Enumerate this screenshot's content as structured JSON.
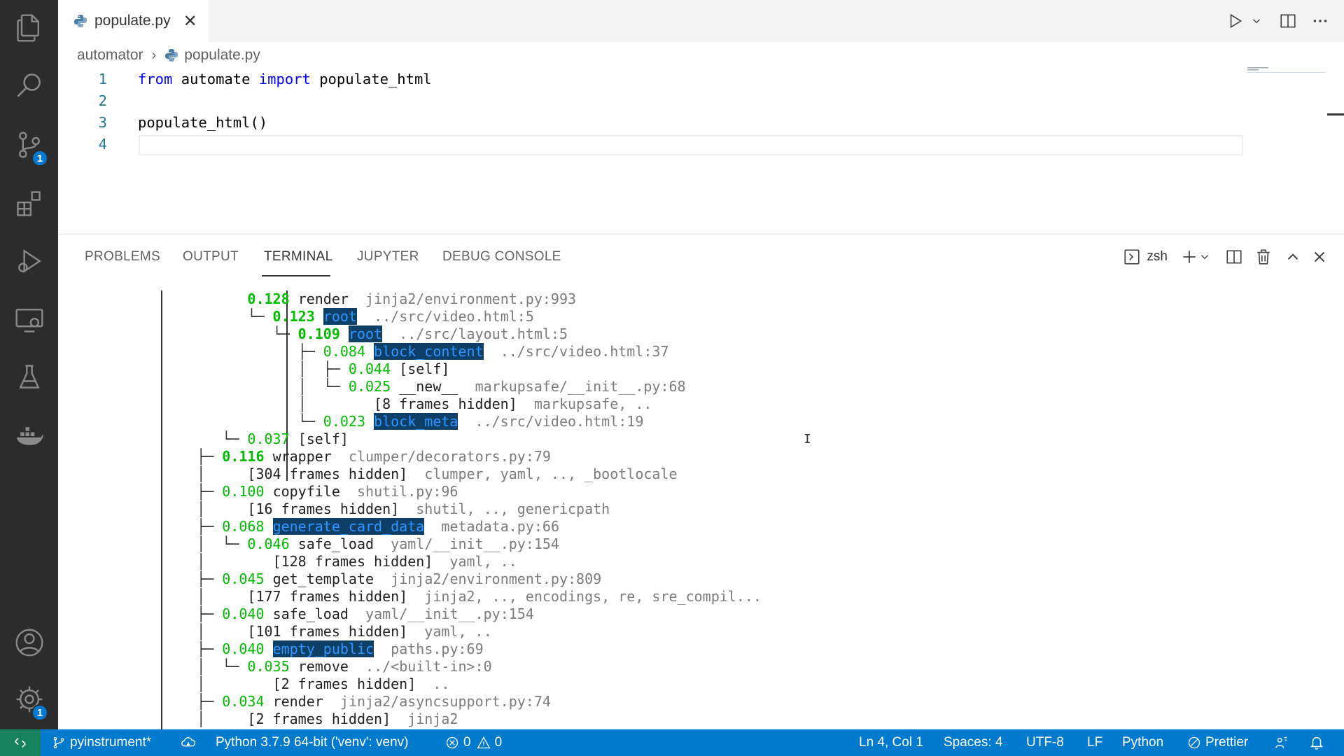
{
  "activity_bar": {
    "scm_badge": "1",
    "settings_badge": "1"
  },
  "editor": {
    "tab_name": "populate.py",
    "breadcrumb": [
      "automator",
      "populate.py"
    ],
    "lines": [
      {
        "num": "1",
        "text": "from automate import populate_html"
      },
      {
        "num": "2",
        "text": ""
      },
      {
        "num": "3",
        "text": "populate_html()"
      },
      {
        "num": "4",
        "text": ""
      }
    ],
    "keywords": [
      "from",
      "import"
    ]
  },
  "panel": {
    "tabs": [
      "PROBLEMS",
      "OUTPUT",
      "TERMINAL",
      "JUPYTER",
      "DEBUG CONSOLE"
    ],
    "active_tab": "TERMINAL",
    "shell": "zsh"
  },
  "terminal": {
    "lines": [
      {
        "prefix": "          ",
        "num": "0.128",
        "name": "render",
        "src": "jinja2/environment.py:993",
        "bold": true
      },
      {
        "prefix": "          └─ ",
        "num": "0.123",
        "name": "root",
        "src": "../src/video.html:5",
        "bold": true,
        "hl": true
      },
      {
        "prefix": "             └─ ",
        "num": "0.109",
        "name": "root",
        "src": "../src/layout.html:5",
        "bold": true,
        "hl": true
      },
      {
        "prefix": "                ├─ ",
        "num": "0.084",
        "name": "block_content",
        "src": "../src/video.html:37",
        "hl": true
      },
      {
        "prefix": "                │  ├─ ",
        "num": "0.044",
        "name": "[self]",
        "src": ""
      },
      {
        "prefix": "                │  └─ ",
        "num": "0.025",
        "name": "__new__",
        "src": "markupsafe/__init__.py:68"
      },
      {
        "prefix": "                │        ",
        "num": "",
        "name": "[8 frames hidden]",
        "src": "markupsafe, .."
      },
      {
        "prefix": "                └─ ",
        "num": "0.023",
        "name": "block_meta",
        "src": "../src/video.html:19",
        "hl": true
      },
      {
        "prefix": "       └─ ",
        "num": "0.037",
        "name": "[self]",
        "src": ""
      },
      {
        "prefix": "    ├─ ",
        "num": "0.116",
        "name": "wrapper",
        "src": "clumper/decorators.py:79",
        "bold": true
      },
      {
        "prefix": "    │     ",
        "num": "",
        "name": "[304 frames hidden]",
        "src": "clumper, yaml, .., _bootlocale"
      },
      {
        "prefix": "    ├─ ",
        "num": "0.100",
        "name": "copyfile",
        "src": "shutil.py:96"
      },
      {
        "prefix": "    │     ",
        "num": "",
        "name": "[16 frames hidden]",
        "src": "shutil, .., genericpath"
      },
      {
        "prefix": "    ├─ ",
        "num": "0.068",
        "name": "generate_card_data",
        "src": "metadata.py:66",
        "hl": true
      },
      {
        "prefix": "    │  └─ ",
        "num": "0.046",
        "name": "safe_load",
        "src": "yaml/__init__.py:154"
      },
      {
        "prefix": "    │        ",
        "num": "",
        "name": "[128 frames hidden]",
        "src": "yaml, .."
      },
      {
        "prefix": "    ├─ ",
        "num": "0.045",
        "name": "get_template",
        "src": "jinja2/environment.py:809"
      },
      {
        "prefix": "    │     ",
        "num": "",
        "name": "[177 frames hidden]",
        "src": "jinja2, .., encodings, re, sre_compil..."
      },
      {
        "prefix": "    ├─ ",
        "num": "0.040",
        "name": "safe_load",
        "src": "yaml/__init__.py:154"
      },
      {
        "prefix": "    │     ",
        "num": "",
        "name": "[101 frames hidden]",
        "src": "yaml, .."
      },
      {
        "prefix": "    ├─ ",
        "num": "0.040",
        "name": "empty_public",
        "src": "paths.py:69",
        "hl": true
      },
      {
        "prefix": "    │  └─ ",
        "num": "0.035",
        "name": "remove",
        "src": "../<built-in>:0"
      },
      {
        "prefix": "    │        ",
        "num": "",
        "name": "[2 frames hidden]",
        "src": ".."
      },
      {
        "prefix": "    ├─ ",
        "num": "0.034",
        "name": "render",
        "src": "jinja2/asyncsupport.py:74"
      },
      {
        "prefix": "    │     ",
        "num": "",
        "name": "[2 frames hidden]",
        "src": "jinja2"
      }
    ]
  },
  "status_bar": {
    "branch": "pyinstrument*",
    "interpreter": "Python 3.7.9 64-bit ('venv': venv)",
    "errors": "0",
    "warnings": "0",
    "cursor_pos": "Ln 4, Col 1",
    "indent": "Spaces: 4",
    "encoding": "UTF-8",
    "eol": "LF",
    "language": "Python",
    "formatter": "Prettier"
  },
  "colors": {
    "accent": "#007acc",
    "remote": "#16825d",
    "activity_bar": "#2c2c2c",
    "terminal_number": "#00bc00",
    "terminal_highlight_bg": "#0e3f66",
    "terminal_highlight_fg": "#2f95ff",
    "keyword": "#0000ff"
  }
}
